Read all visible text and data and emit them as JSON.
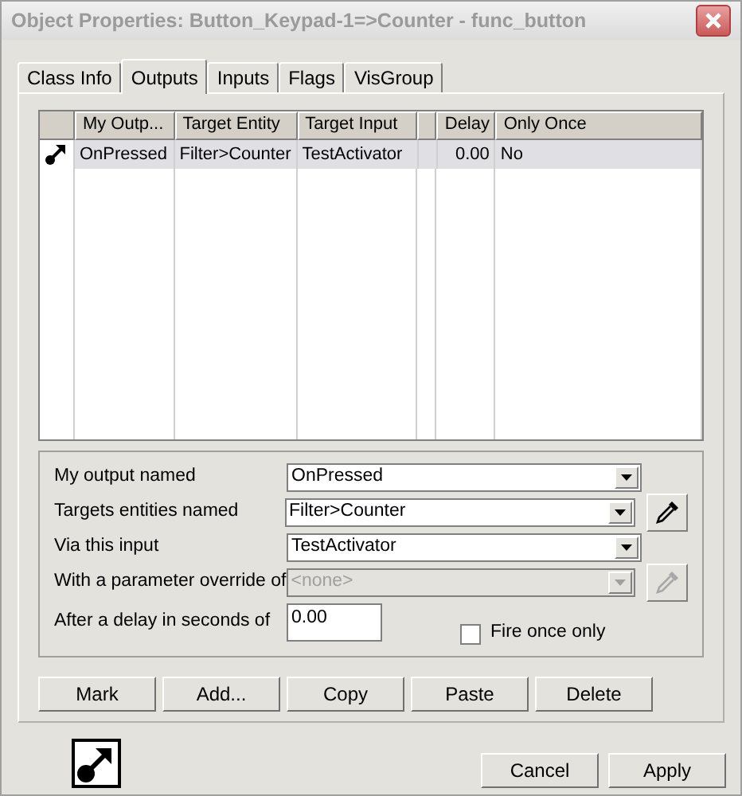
{
  "window": {
    "title": "Object Properties: Button_Keypad-1=>Counter - func_button"
  },
  "tabs": [
    {
      "label": "Class Info",
      "selected": false
    },
    {
      "label": "Outputs",
      "selected": true
    },
    {
      "label": "Inputs",
      "selected": false
    },
    {
      "label": "Flags",
      "selected": false
    },
    {
      "label": "VisGroup",
      "selected": false
    }
  ],
  "outputs_list": {
    "columns": [
      "My Outp...",
      "Target Entity",
      "Target Input",
      "",
      "Delay",
      "Only Once"
    ],
    "rows": [
      {
        "selected": true,
        "cells": [
          "OnPressed",
          "Filter>Counter",
          "TestActivator",
          "",
          "0.00",
          "No"
        ]
      }
    ]
  },
  "form": [
    {
      "kind": "combo",
      "label": "My output named",
      "value": "OnPressed",
      "disabled": false,
      "picker": false
    },
    {
      "kind": "combo",
      "label": "Targets entities named",
      "value": "Filter>Counter",
      "disabled": false,
      "picker": true
    },
    {
      "kind": "combo",
      "label": "Via this input",
      "value": "TestActivator",
      "disabled": false,
      "picker": false
    },
    {
      "kind": "combo",
      "label": "With a parameter override of",
      "value": "<none>",
      "disabled": true,
      "picker": true
    },
    {
      "kind": "text",
      "label": "After a delay in seconds of",
      "value": "0.00",
      "disabled": false,
      "picker": false
    }
  ],
  "fire_once": {
    "label": "Fire once only",
    "checked": false
  },
  "list_buttons": [
    "Mark",
    "Add...",
    "Copy",
    "Paste",
    "Delete"
  ],
  "dialog_buttons": [
    "Cancel",
    "Apply"
  ]
}
